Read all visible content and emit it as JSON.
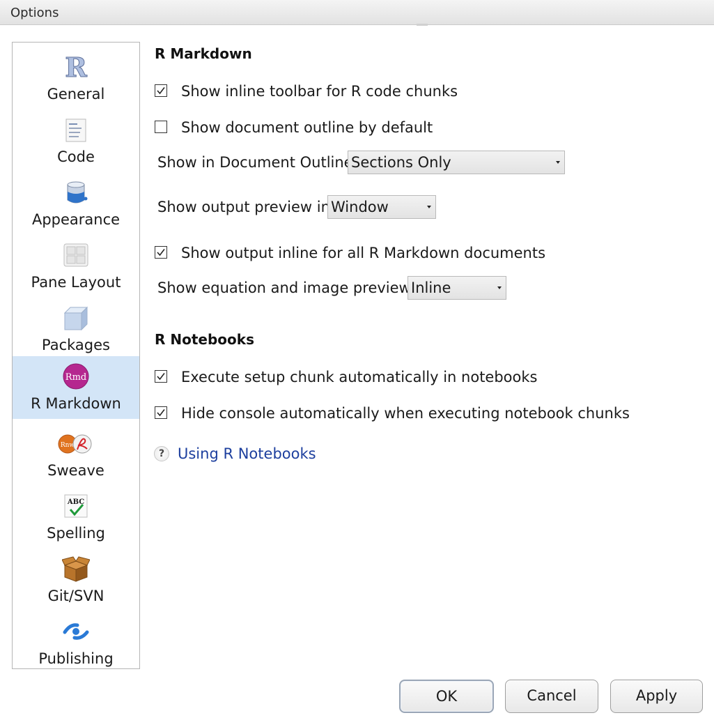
{
  "window": {
    "title": "Options"
  },
  "sidebar": {
    "items": [
      {
        "label": "General",
        "icon": "r-logo-icon"
      },
      {
        "label": "Code",
        "icon": "code-document-icon"
      },
      {
        "label": "Appearance",
        "icon": "paint-bucket-icon"
      },
      {
        "label": "Pane Layout",
        "icon": "pane-grid-icon"
      },
      {
        "label": "Packages",
        "icon": "package-box-icon"
      },
      {
        "label": "R Markdown",
        "icon": "rmd-icon",
        "selected": true
      },
      {
        "label": "Sweave",
        "icon": "sweave-pdf-icon"
      },
      {
        "label": "Spelling",
        "icon": "spellcheck-icon"
      },
      {
        "label": "Git/SVN",
        "icon": "cardboard-box-icon"
      },
      {
        "label": "Publishing",
        "icon": "publish-icon"
      }
    ],
    "selected_color": "#d3e5f7"
  },
  "rmarkdown": {
    "heading": "R Markdown",
    "inline_toolbar": {
      "label": "Show inline toolbar for R code chunks",
      "checked": true
    },
    "doc_outline_default": {
      "label": "Show document outline by default",
      "checked": false
    },
    "outline_show": {
      "label": "Show in Document Outline:",
      "value": "Sections Only"
    },
    "preview_in": {
      "label": "Show output preview in:",
      "value": "Window"
    },
    "output_inline": {
      "label": "Show output inline for all R Markdown documents",
      "checked": true
    },
    "equation_previews": {
      "label": "Show equation and image previews:",
      "value": "Inline"
    }
  },
  "notebooks": {
    "heading": "R Notebooks",
    "exec_setup": {
      "label": "Execute setup chunk automatically in notebooks",
      "checked": true
    },
    "hide_console": {
      "label": "Hide console automatically when executing notebook chunks",
      "checked": true
    },
    "help_link": "Using R Notebooks"
  },
  "buttons": {
    "ok": "OK",
    "cancel": "Cancel",
    "apply": "Apply"
  },
  "colors": {
    "link": "#1d3f9e",
    "selection": "#d3e5f7"
  }
}
